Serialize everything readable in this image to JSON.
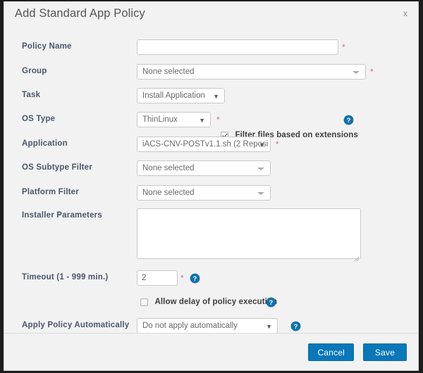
{
  "dialog": {
    "title": "Add Standard App Policy",
    "close_label": "x"
  },
  "fields": {
    "policy_name": {
      "label": "Policy Name",
      "value": "",
      "placeholder": "",
      "required_mark": "*"
    },
    "group": {
      "label": "Group",
      "value": "None selected",
      "required_mark": "*"
    },
    "task": {
      "label": "Task",
      "value": "Install Application"
    },
    "os_type": {
      "label": "OS Type",
      "value": "ThinLinux",
      "required_mark": "*"
    },
    "filter_files": {
      "label": "Filter files based on extensions",
      "checked": true,
      "help_icon": "help-circle-icon"
    },
    "application": {
      "label": "Application",
      "value": "iACS-CNV-POSTv1.1.sh (2 Reposi",
      "required_mark": "*"
    },
    "os_subtype_filter": {
      "label": "OS Subtype Filter",
      "value": "None selected"
    },
    "platform_filter": {
      "label": "Platform Filter",
      "value": "None selected"
    },
    "installer_parameters": {
      "label": "Installer Parameters",
      "value": "",
      "placeholder": ""
    },
    "timeout": {
      "label": "Timeout (1 - 999 min.)",
      "value": "2",
      "required_mark": "*",
      "help_icon": "help-circle-icon"
    },
    "allow_delay": {
      "label": "Allow delay of policy execution",
      "checked": false,
      "help_icon": "help-circle-icon"
    },
    "apply_policy_automatically": {
      "label": "Apply Policy Automatically",
      "value": "Do not apply automatically",
      "help_icon": "help-circle-icon"
    }
  },
  "footer": {
    "cancel_label": "Cancel",
    "save_label": "Save"
  },
  "colors": {
    "accent_blue": "#0a77b8",
    "label_blue": "#49576b",
    "required_red": "#c9737f",
    "dialog_bg": "#f2f2f2"
  }
}
